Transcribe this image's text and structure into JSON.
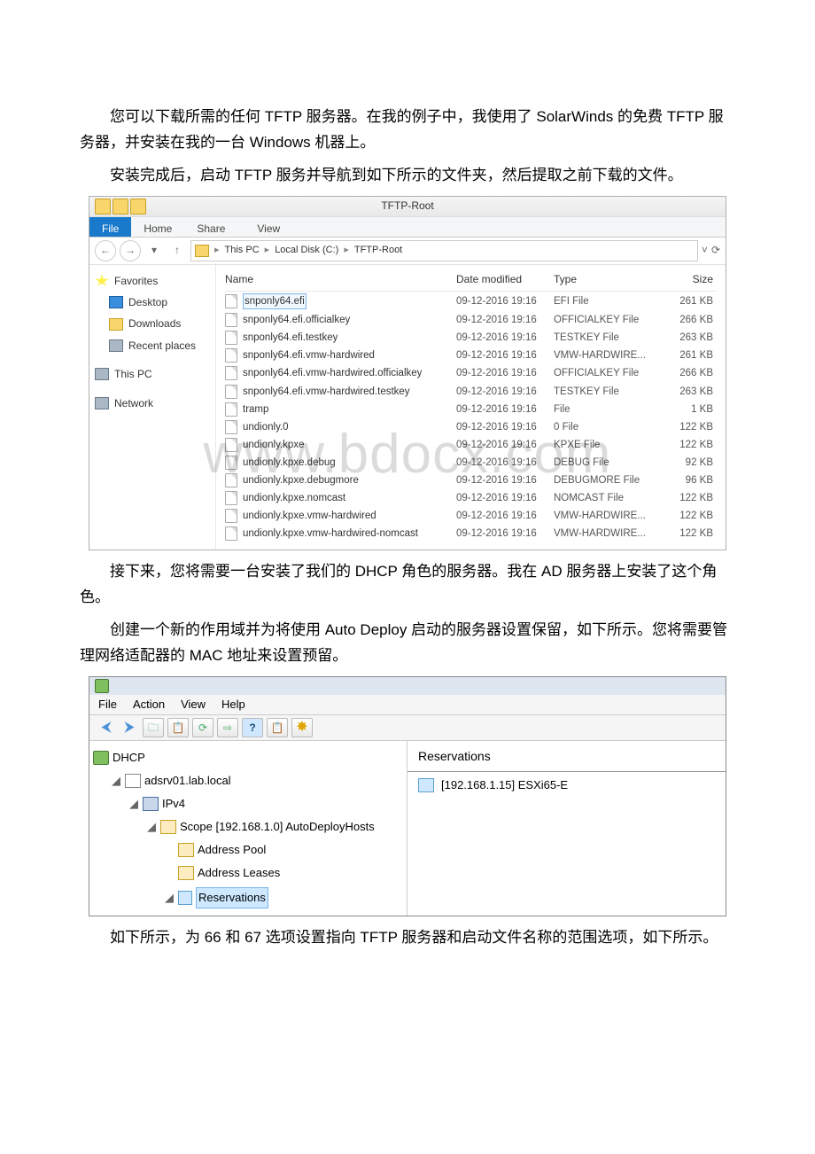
{
  "doc": {
    "p1": "您可以下载所需的任何 TFTP 服务器。在我的例子中，我使用了 SolarWinds 的免费 TFTP 服务器，并安装在我的一台 Windows 机器上。",
    "p2": "安装完成后，启动 TFTP 服务并导航到如下所示的文件夹，然后提取之前下载的文件。",
    "p3": "接下来，您将需要一台安装了我们的 DHCP 角色的服务器。我在 AD 服务器上安装了这个角色。",
    "p4": "创建一个新的作用域并为将使用 Auto Deploy 启动的服务器设置保留，如下所示。您将需要管理网络适配器的 MAC 地址来设置预留。",
    "p5": "如下所示，为 66 和 67 选项设置指向 TFTP 服务器和启动文件名称的范围选项，如下所示。"
  },
  "watermark": "www.bdocx.com",
  "explorer": {
    "title": "TFTP-Root",
    "ribbon": {
      "file": "File",
      "home": "Home",
      "share": "Share",
      "view": "View"
    },
    "breadcrumb": {
      "pc": "This PC",
      "disk": "Local Disk (C:)",
      "folder": "TFTP-Root"
    },
    "sidebar": {
      "favorites": "Favorites",
      "desktop": "Desktop",
      "downloads": "Downloads",
      "recent": "Recent places",
      "thispc": "This PC",
      "network": "Network"
    },
    "cols": {
      "name": "Name",
      "modified": "Date modified",
      "type": "Type",
      "size": "Size"
    },
    "rows": [
      {
        "n": "snponly64.efi",
        "m": "09-12-2016 19:16",
        "t": "EFI File",
        "s": "261 KB",
        "sel": true
      },
      {
        "n": "snponly64.efi.officialkey",
        "m": "09-12-2016 19:16",
        "t": "OFFICIALKEY File",
        "s": "266 KB"
      },
      {
        "n": "snponly64.efi.testkey",
        "m": "09-12-2016 19:16",
        "t": "TESTKEY File",
        "s": "263 KB"
      },
      {
        "n": "snponly64.efi.vmw-hardwired",
        "m": "09-12-2016 19:16",
        "t": "VMW-HARDWIRE...",
        "s": "261 KB"
      },
      {
        "n": "snponly64.efi.vmw-hardwired.officialkey",
        "m": "09-12-2016 19:16",
        "t": "OFFICIALKEY File",
        "s": "266 KB"
      },
      {
        "n": "snponly64.efi.vmw-hardwired.testkey",
        "m": "09-12-2016 19:16",
        "t": "TESTKEY File",
        "s": "263 KB"
      },
      {
        "n": "tramp",
        "m": "09-12-2016 19:16",
        "t": "File",
        "s": "1 KB"
      },
      {
        "n": "undionly.0",
        "m": "09-12-2016 19:16",
        "t": "0 File",
        "s": "122 KB"
      },
      {
        "n": "undionly.kpxe",
        "m": "09-12-2016 19:16",
        "t": "KPXE File",
        "s": "122 KB"
      },
      {
        "n": "undionly.kpxe.debug",
        "m": "09-12-2016 19:16",
        "t": "DEBUG File",
        "s": "92 KB"
      },
      {
        "n": "undionly.kpxe.debugmore",
        "m": "09-12-2016 19:16",
        "t": "DEBUGMORE File",
        "s": "96 KB"
      },
      {
        "n": "undionly.kpxe.nomcast",
        "m": "09-12-2016 19:16",
        "t": "NOMCAST File",
        "s": "122 KB"
      },
      {
        "n": "undionly.kpxe.vmw-hardwired",
        "m": "09-12-2016 19:16",
        "t": "VMW-HARDWIRE...",
        "s": "122 KB"
      },
      {
        "n": "undionly.kpxe.vmw-hardwired-nomcast",
        "m": "09-12-2016 19:16",
        "t": "VMW-HARDWIRE...",
        "s": "122 KB"
      }
    ]
  },
  "mmc": {
    "menu": {
      "file": "File",
      "action": "Action",
      "view": "View",
      "help": "Help"
    },
    "tree": {
      "root": "DHCP",
      "server": "adsrv01.lab.local",
      "ipv4": "IPv4",
      "scope": "Scope [192.168.1.0] AutoDeployHosts",
      "pool": "Address Pool",
      "leases": "Address Leases",
      "reservations": "Reservations"
    },
    "right": {
      "header": "Reservations",
      "item": "[192.168.1.15] ESXi65-E"
    }
  }
}
